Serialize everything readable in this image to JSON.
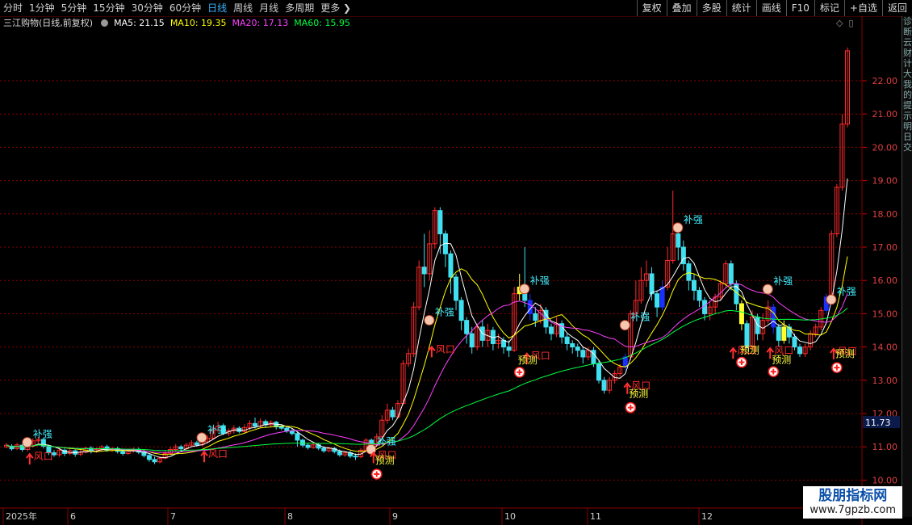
{
  "periods": [
    {
      "label": "分时",
      "active": false
    },
    {
      "label": "1分钟",
      "active": false
    },
    {
      "label": "5分钟",
      "active": false
    },
    {
      "label": "15分钟",
      "active": false
    },
    {
      "label": "30分钟",
      "active": false
    },
    {
      "label": "60分钟",
      "active": false
    },
    {
      "label": "日线",
      "active": true
    },
    {
      "label": "周线",
      "active": false
    },
    {
      "label": "月线",
      "active": false
    },
    {
      "label": "多周期",
      "active": false
    },
    {
      "label": "更多",
      "active": false
    }
  ],
  "more_chevron": "❯",
  "tools": [
    "复权",
    "叠加",
    "多股",
    "统计",
    "画线",
    "F10",
    "标记",
    "+自选",
    "返回"
  ],
  "stock": {
    "name": "三江购物(日线,前复权)"
  },
  "ma": {
    "ma5_label": "MA5: 21.15",
    "ma10_label": "MA10: 19.35",
    "ma20_label": "MA20: 17.13",
    "ma60_label": "MA60: 15.95"
  },
  "colors": {
    "up": "#ff2a2a",
    "down": "#40e0f0",
    "ma5": "#ffffff",
    "ma10": "#ffff00",
    "ma20": "#ff40ff",
    "ma60": "#00ff40",
    "grid": "#8a0000",
    "blue_bar": "#1a30ff",
    "yellow_bar": "#ffff30"
  },
  "right_strip_chars": [
    "诊",
    "断",
    "云",
    "财",
    "计",
    "大",
    "我",
    "的",
    "提",
    "示",
    "明",
    "日",
    "交"
  ],
  "chart_data": {
    "type": "candlestick",
    "y_ticks": [
      "22.00",
      "21.00",
      "20.00",
      "19.00",
      "18.00",
      "17.00",
      "16.00",
      "15.00",
      "14.00",
      "13.00",
      "12.00",
      "11.00",
      "10.00"
    ],
    "current_price_label": "11.73",
    "x_labels": [
      "2025年",
      "6",
      "7",
      "8",
      "9",
      "10",
      "11",
      "12"
    ],
    "ylim": [
      9.6,
      23.0
    ],
    "annotations": {
      "buqiang": "补强",
      "fengkou": "风口",
      "yuce": "预测"
    },
    "candles": [
      [
        11.0,
        11.05,
        10.95,
        11.12
      ],
      [
        11.02,
        10.94,
        10.88,
        11.08
      ],
      [
        10.95,
        11.06,
        10.9,
        11.12
      ],
      [
        11.05,
        10.92,
        10.85,
        11.1
      ],
      [
        10.92,
        11.02,
        10.86,
        11.08
      ],
      [
        11.02,
        11.18,
        10.98,
        11.25
      ],
      [
        11.18,
        11.22,
        11.1,
        11.3
      ],
      [
        11.22,
        11.02,
        10.95,
        11.28
      ],
      [
        11.0,
        10.82,
        10.75,
        11.05
      ],
      [
        10.82,
        10.76,
        10.7,
        10.9
      ],
      [
        10.76,
        10.9,
        10.7,
        10.95
      ],
      [
        10.9,
        10.8,
        10.72,
        10.95
      ],
      [
        10.8,
        10.88,
        10.75,
        10.93
      ],
      [
        10.88,
        10.78,
        10.7,
        10.92
      ],
      [
        10.78,
        10.84,
        10.72,
        10.9
      ],
      [
        10.84,
        10.96,
        10.8,
        11.0
      ],
      [
        10.96,
        10.86,
        10.8,
        11.02
      ],
      [
        10.86,
        10.92,
        10.82,
        10.98
      ],
      [
        10.92,
        11.0,
        10.86,
        11.05
      ],
      [
        11.0,
        10.9,
        10.85,
        11.06
      ],
      [
        10.9,
        10.95,
        10.84,
        11.0
      ],
      [
        10.95,
        10.86,
        10.8,
        11.0
      ],
      [
        10.86,
        10.8,
        10.74,
        10.92
      ],
      [
        10.8,
        10.88,
        10.76,
        10.94
      ],
      [
        10.88,
        10.92,
        10.82,
        10.98
      ],
      [
        10.92,
        10.84,
        10.78,
        10.98
      ],
      [
        10.84,
        10.74,
        10.68,
        10.9
      ],
      [
        10.74,
        10.62,
        10.55,
        10.8
      ],
      [
        10.62,
        10.55,
        10.48,
        10.7
      ],
      [
        10.55,
        10.66,
        10.5,
        10.72
      ],
      [
        10.66,
        10.8,
        10.62,
        10.88
      ],
      [
        10.8,
        10.92,
        10.76,
        11.0
      ],
      [
        10.92,
        11.0,
        10.86,
        11.08
      ],
      [
        11.0,
        10.94,
        10.88,
        11.06
      ],
      [
        10.94,
        11.05,
        10.9,
        11.12
      ],
      [
        11.05,
        11.12,
        11.0,
        11.2
      ],
      [
        11.12,
        11.06,
        11.0,
        11.18
      ],
      [
        11.06,
        11.15,
        11.02,
        11.22
      ],
      [
        11.15,
        11.26,
        11.1,
        11.35
      ],
      [
        11.26,
        11.5,
        11.2,
        11.6
      ],
      [
        11.5,
        11.62,
        11.42,
        11.75
      ],
      [
        11.62,
        11.4,
        11.35,
        11.7
      ],
      [
        11.4,
        11.48,
        11.32,
        11.55
      ],
      [
        11.48,
        11.56,
        11.4,
        11.65
      ],
      [
        11.56,
        11.46,
        11.4,
        11.62
      ],
      [
        11.46,
        11.58,
        11.42,
        11.68
      ],
      [
        11.58,
        11.7,
        11.5,
        11.8
      ],
      [
        11.7,
        11.62,
        11.55,
        11.88
      ],
      [
        11.62,
        11.76,
        11.58,
        11.85
      ],
      [
        11.76,
        11.66,
        11.6,
        11.82
      ],
      [
        11.66,
        11.74,
        11.6,
        11.8
      ],
      [
        11.74,
        11.6,
        11.52,
        11.78
      ],
      [
        11.6,
        11.56,
        11.5,
        11.66
      ],
      [
        11.56,
        11.48,
        11.42,
        11.62
      ],
      [
        11.48,
        11.4,
        11.34,
        11.55
      ],
      [
        11.4,
        11.2,
        11.0,
        11.45
      ],
      [
        11.2,
        11.05,
        10.98,
        11.25
      ],
      [
        11.05,
        10.98,
        10.92,
        11.1
      ],
      [
        10.98,
        11.06,
        10.94,
        11.12
      ],
      [
        11.06,
        10.96,
        10.9,
        11.12
      ],
      [
        10.96,
        10.88,
        10.82,
        11.02
      ],
      [
        10.88,
        10.95,
        10.84,
        11.0
      ],
      [
        10.95,
        10.86,
        10.8,
        11.0
      ],
      [
        10.86,
        10.76,
        10.7,
        10.92
      ],
      [
        10.76,
        10.82,
        10.7,
        10.88
      ],
      [
        10.82,
        10.72,
        10.66,
        10.88
      ],
      [
        10.72,
        10.7,
        10.6,
        10.8
      ],
      [
        10.7,
        10.9,
        10.66,
        10.96
      ],
      [
        10.9,
        11.2,
        10.86,
        11.26
      ],
      [
        11.2,
        11.05,
        10.98,
        11.25
      ],
      [
        11.05,
        11.3,
        11.0,
        11.4
      ],
      [
        11.3,
        11.8,
        11.25,
        11.95
      ],
      [
        11.8,
        12.1,
        11.7,
        12.3
      ],
      [
        12.1,
        11.9,
        11.8,
        12.2
      ],
      [
        11.9,
        12.3,
        11.85,
        12.4
      ],
      [
        12.3,
        13.5,
        12.25,
        13.6
      ],
      [
        13.5,
        13.8,
        13.4,
        13.95
      ],
      [
        13.8,
        15.2,
        13.7,
        15.35
      ],
      [
        15.2,
        16.4,
        15.1,
        16.6
      ],
      [
        16.4,
        16.2,
        15.8,
        17.4
      ],
      [
        16.2,
        17.1,
        16.0,
        17.5
      ],
      [
        17.1,
        18.1,
        16.95,
        18.2
      ],
      [
        18.1,
        17.4,
        16.8,
        18.2
      ],
      [
        17.4,
        16.8,
        16.4,
        17.5
      ],
      [
        16.8,
        16.1,
        15.6,
        16.9
      ],
      [
        16.1,
        15.4,
        15.1,
        16.2
      ],
      [
        15.4,
        14.8,
        14.5,
        15.5
      ],
      [
        14.8,
        14.4,
        14.1,
        14.9
      ],
      [
        14.4,
        14.0,
        13.8,
        14.6
      ],
      [
        14.0,
        14.6,
        13.9,
        14.7
      ],
      [
        14.6,
        14.2,
        14.0,
        14.8
      ],
      [
        14.2,
        14.5,
        14.0,
        14.7
      ],
      [
        14.5,
        14.1,
        13.9,
        14.6
      ],
      [
        14.1,
        14.2,
        13.95,
        14.4
      ],
      [
        14.2,
        14.0,
        13.8,
        14.3
      ],
      [
        14.0,
        13.9,
        13.7,
        14.2
      ],
      [
        13.9,
        15.6,
        13.85,
        15.8
      ],
      [
        15.6,
        15.8,
        15.4,
        16.2
      ],
      [
        15.8,
        15.4,
        15.2,
        17.0
      ],
      [
        15.4,
        15.0,
        14.8,
        15.6
      ],
      [
        15.0,
        14.8,
        14.6,
        15.2
      ],
      [
        14.8,
        15.1,
        14.7,
        15.3
      ],
      [
        15.1,
        14.6,
        14.4,
        15.2
      ],
      [
        14.6,
        14.4,
        14.2,
        14.7
      ],
      [
        14.4,
        14.7,
        14.3,
        14.9
      ],
      [
        14.7,
        14.3,
        14.1,
        14.8
      ],
      [
        14.3,
        14.1,
        13.9,
        14.4
      ],
      [
        14.1,
        14.0,
        13.8,
        14.2
      ],
      [
        14.0,
        13.9,
        13.7,
        14.1
      ],
      [
        13.9,
        13.7,
        13.5,
        14.0
      ],
      [
        13.7,
        13.9,
        13.6,
        14.0
      ],
      [
        13.9,
        13.5,
        13.4,
        14.0
      ],
      [
        13.5,
        13.0,
        12.9,
        13.6
      ],
      [
        13.0,
        12.7,
        12.6,
        13.1
      ],
      [
        12.7,
        13.0,
        12.6,
        13.1
      ],
      [
        13.0,
        13.2,
        12.9,
        13.3
      ],
      [
        13.2,
        13.4,
        13.1,
        13.5
      ],
      [
        13.4,
        13.7,
        13.3,
        13.8
      ],
      [
        13.7,
        15.0,
        13.6,
        15.1
      ],
      [
        15.0,
        15.4,
        14.9,
        16.0
      ],
      [
        15.4,
        16.0,
        15.3,
        16.4
      ],
      [
        16.0,
        16.2,
        15.8,
        16.6
      ],
      [
        16.2,
        15.6,
        15.4,
        16.4
      ],
      [
        15.6,
        15.2,
        14.9,
        15.7
      ],
      [
        15.2,
        15.8,
        15.1,
        16.0
      ],
      [
        15.8,
        16.6,
        15.7,
        17.0
      ],
      [
        16.6,
        17.4,
        16.5,
        18.7
      ],
      [
        17.4,
        17.0,
        16.6,
        17.6
      ],
      [
        17.0,
        16.5,
        16.3,
        17.2
      ],
      [
        16.5,
        16.0,
        15.7,
        16.6
      ],
      [
        16.0,
        15.7,
        15.4,
        16.2
      ],
      [
        15.7,
        15.4,
        15.2,
        15.8
      ],
      [
        15.4,
        15.0,
        14.8,
        15.5
      ],
      [
        15.0,
        15.2,
        14.8,
        15.4
      ],
      [
        15.2,
        15.5,
        15.0,
        15.6
      ],
      [
        15.5,
        15.9,
        15.4,
        16.0
      ],
      [
        15.9,
        16.5,
        15.8,
        16.6
      ],
      [
        16.5,
        15.9,
        15.7,
        16.6
      ],
      [
        15.9,
        15.3,
        15.1,
        16.0
      ],
      [
        15.3,
        14.7,
        14.5,
        15.4
      ],
      [
        14.7,
        14.0,
        13.9,
        14.8
      ],
      [
        14.0,
        14.9,
        13.9,
        15.1
      ],
      [
        14.9,
        14.4,
        14.2,
        15.0
      ],
      [
        14.4,
        14.8,
        14.2,
        15.0
      ],
      [
        14.8,
        15.2,
        14.7,
        15.4
      ],
      [
        15.2,
        14.6,
        14.4,
        15.3
      ],
      [
        14.6,
        14.2,
        14.0,
        14.7
      ],
      [
        14.2,
        14.6,
        14.1,
        14.8
      ],
      [
        14.6,
        14.3,
        14.1,
        14.7
      ],
      [
        14.3,
        14.0,
        13.9,
        14.4
      ],
      [
        14.0,
        13.8,
        13.7,
        14.1
      ],
      [
        13.8,
        14.0,
        13.7,
        14.1
      ],
      [
        14.0,
        14.4,
        13.9,
        14.5
      ],
      [
        14.4,
        14.6,
        14.3,
        14.7
      ],
      [
        14.6,
        15.1,
        14.5,
        15.2
      ],
      [
        15.1,
        15.5,
        15.0,
        15.6
      ],
      [
        15.5,
        17.4,
        15.4,
        17.5
      ],
      [
        17.4,
        18.8,
        17.3,
        18.9
      ],
      [
        18.8,
        20.7,
        18.7,
        21.0
      ],
      [
        20.7,
        22.9,
        20.6,
        23.0
      ]
    ],
    "blue_bars": [
      99,
      117,
      124,
      145,
      155
    ],
    "yellow_bars": [
      97,
      139,
      147
    ],
    "buqiang_at": [
      [
        5,
        11.28
      ],
      [
        38,
        11.42
      ],
      [
        70,
        11.07
      ],
      [
        81,
        14.95
      ],
      [
        99,
        15.89
      ],
      [
        118,
        14.8
      ],
      [
        128,
        17.73
      ],
      [
        145,
        15.88
      ],
      [
        157,
        15.57
      ]
    ],
    "fengkou_at": [
      [
        5,
        10.76
      ],
      [
        38,
        10.83
      ],
      [
        70,
        10.8
      ],
      [
        81,
        13.98
      ],
      [
        99,
        13.78
      ],
      [
        118,
        12.88
      ],
      [
        138,
        13.94
      ],
      [
        145,
        13.94
      ],
      [
        157,
        13.92
      ]
    ],
    "yuce_at": [
      [
        70,
        10.5
      ],
      [
        97,
        13.51
      ],
      [
        118,
        12.5
      ],
      [
        139,
        13.81
      ],
      [
        145,
        13.52
      ],
      [
        157,
        13.7
      ]
    ],
    "plus_at": [
      [
        70,
        10.18
      ],
      [
        97,
        13.24
      ],
      [
        118,
        12.18
      ],
      [
        139,
        13.54
      ],
      [
        145,
        13.26
      ],
      [
        157,
        13.38
      ]
    ],
    "ma_last_overlay": {
      "ma5": 21.15,
      "ma10": 19.35,
      "ma20": 17.13,
      "ma60": 15.95
    }
  },
  "watermark": {
    "line1": "股朋指标网",
    "line2": "www.7gpzb.com"
  }
}
